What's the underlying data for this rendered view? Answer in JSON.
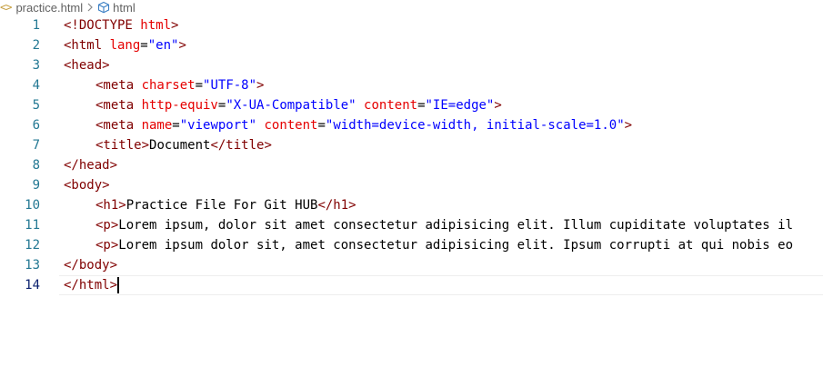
{
  "breadcrumb": {
    "file_icon": "<>",
    "file": "practice.html",
    "separator": ">",
    "symbol": "html"
  },
  "editor": {
    "current_line": 14,
    "lines": [
      {
        "n": "1",
        "parts": [
          [
            "tag",
            "<!DOCTYPE "
          ],
          [
            "attr",
            "html"
          ],
          [
            "tag",
            ">"
          ]
        ]
      },
      {
        "n": "2",
        "parts": [
          [
            "tag",
            "<html "
          ],
          [
            "attr",
            "lang"
          ],
          [
            "txt",
            "="
          ],
          [
            "val",
            "\"en\""
          ],
          [
            "tag",
            ">"
          ]
        ]
      },
      {
        "n": "3",
        "parts": [
          [
            "tag",
            "<head>"
          ]
        ]
      },
      {
        "n": "4",
        "indent": 1,
        "parts": [
          [
            "tag",
            "<meta "
          ],
          [
            "attr",
            "charset"
          ],
          [
            "txt",
            "="
          ],
          [
            "val",
            "\"UTF-8\""
          ],
          [
            "tag",
            ">"
          ]
        ]
      },
      {
        "n": "5",
        "indent": 1,
        "parts": [
          [
            "tag",
            "<meta "
          ],
          [
            "attr",
            "http-equiv"
          ],
          [
            "txt",
            "="
          ],
          [
            "val",
            "\"X-UA-Compatible\""
          ],
          [
            "txt",
            " "
          ],
          [
            "attr",
            "content"
          ],
          [
            "txt",
            "="
          ],
          [
            "val",
            "\"IE=edge\""
          ],
          [
            "tag",
            ">"
          ]
        ]
      },
      {
        "n": "6",
        "indent": 1,
        "parts": [
          [
            "tag",
            "<meta "
          ],
          [
            "attr",
            "name"
          ],
          [
            "txt",
            "="
          ],
          [
            "val",
            "\"viewport\""
          ],
          [
            "txt",
            " "
          ],
          [
            "attr",
            "content"
          ],
          [
            "txt",
            "="
          ],
          [
            "val",
            "\"width=device-width, initial-scale=1.0\""
          ],
          [
            "tag",
            ">"
          ]
        ]
      },
      {
        "n": "7",
        "indent": 1,
        "parts": [
          [
            "tag",
            "<title>"
          ],
          [
            "txt",
            "Document"
          ],
          [
            "tag",
            "</title>"
          ]
        ]
      },
      {
        "n": "8",
        "parts": [
          [
            "tag",
            "</head>"
          ]
        ]
      },
      {
        "n": "9",
        "parts": [
          [
            "tag",
            "<body>"
          ]
        ]
      },
      {
        "n": "10",
        "indent": 1,
        "parts": [
          [
            "tag",
            "<h1>"
          ],
          [
            "txt",
            "Practice File For Git HUB"
          ],
          [
            "tag",
            "</h1>"
          ]
        ]
      },
      {
        "n": "11",
        "indent": 1,
        "parts": [
          [
            "tag",
            "<p>"
          ],
          [
            "txt",
            "Lorem ipsum, dolor sit amet consectetur adipisicing elit. Illum cupiditate voluptates il"
          ]
        ]
      },
      {
        "n": "12",
        "indent": 1,
        "parts": [
          [
            "tag",
            "<p>"
          ],
          [
            "txt",
            "Lorem ipsum dolor sit, amet consectetur adipisicing elit. Ipsum corrupti at qui nobis eo"
          ]
        ]
      },
      {
        "n": "13",
        "parts": [
          [
            "tag",
            "</body>"
          ]
        ]
      },
      {
        "n": "14",
        "parts": [
          [
            "tag",
            "</html>"
          ]
        ],
        "cursor": true
      }
    ]
  },
  "colors": {
    "tag": "#800000",
    "attribute": "#e50000",
    "string": "#0000ff",
    "line_number": "#237893",
    "file_icon": "#c59d3c"
  },
  "icons": {
    "file": "html-file-icon",
    "symbol": "cube-icon"
  }
}
